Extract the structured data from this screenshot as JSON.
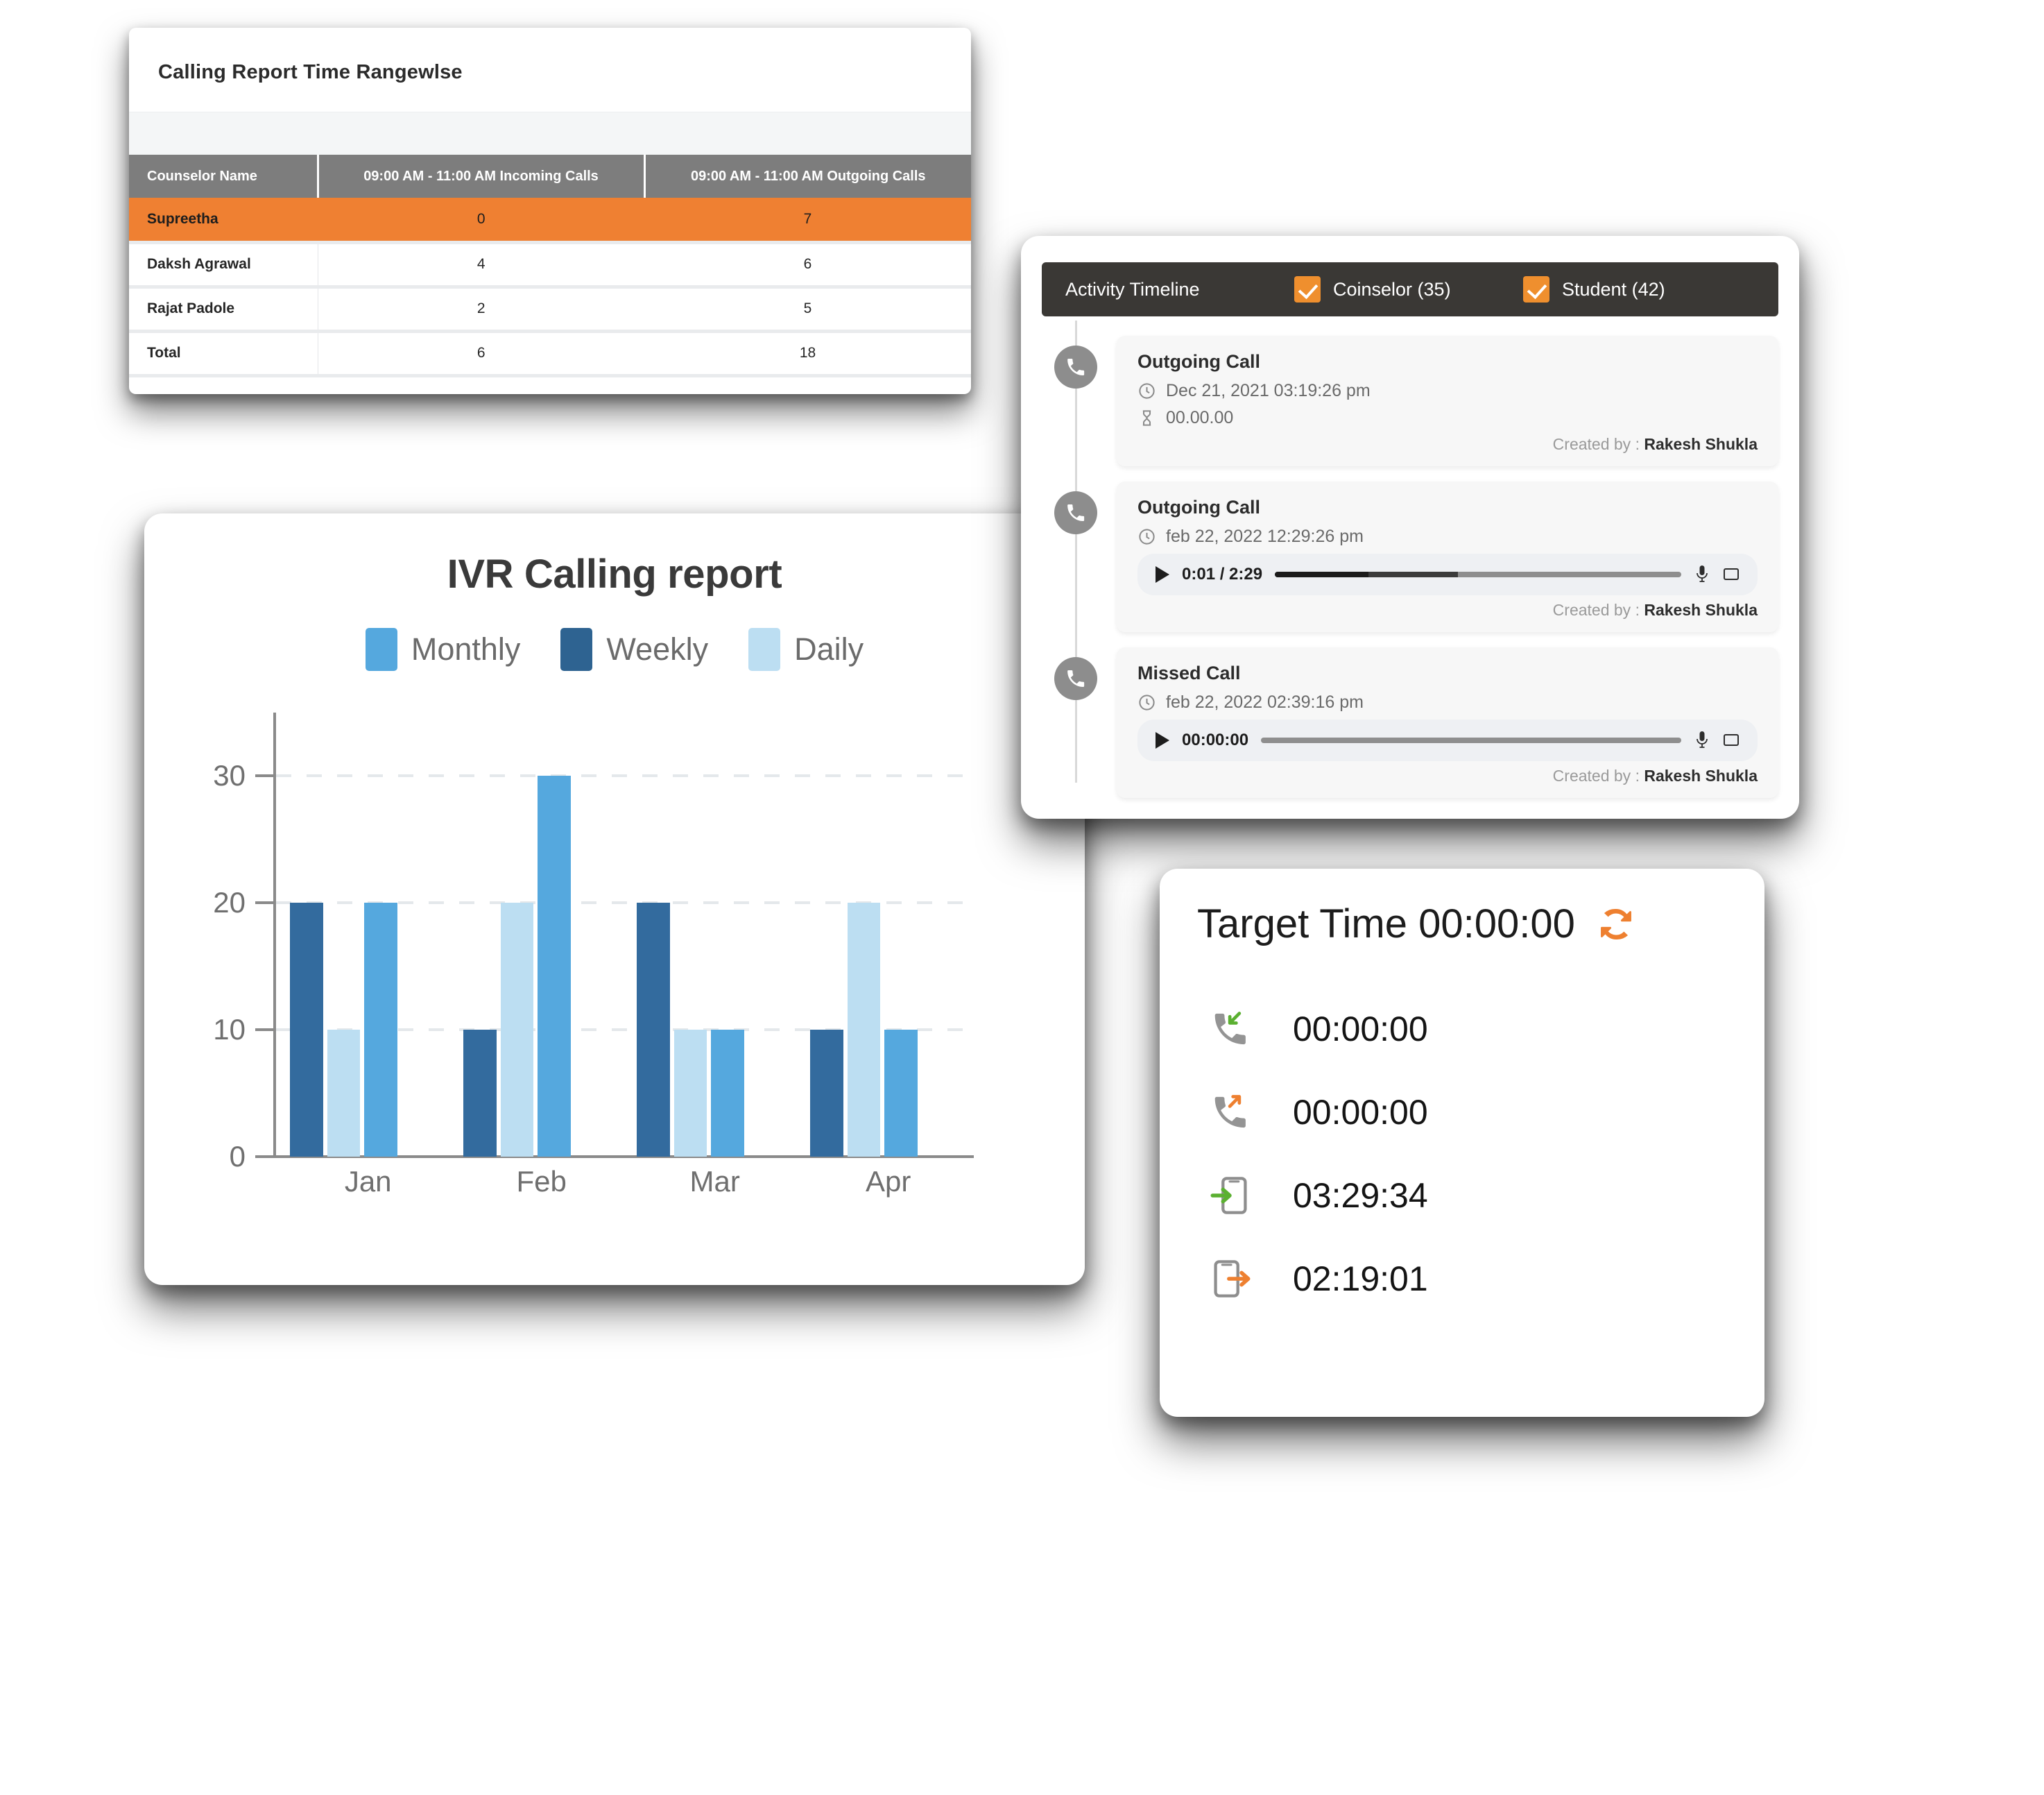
{
  "report": {
    "title": "Calling Report Time Rangewlse",
    "columns": [
      "Counselor Name",
      "09:00 AM - 11:00 AM Incoming Calls",
      "09:00 AM - 11:00 AM Outgoing Calls"
    ],
    "rows": [
      {
        "name": "Supreetha",
        "incoming": "0",
        "outgoing": "7",
        "highlight": true
      },
      {
        "name": "Daksh Agrawal",
        "incoming": "4",
        "outgoing": "6",
        "highlight": false
      },
      {
        "name": "Rajat Padole",
        "incoming": "2",
        "outgoing": "5",
        "highlight": false
      },
      {
        "name": "Total",
        "incoming": "6",
        "outgoing": "18",
        "highlight": false
      }
    ],
    "colors": {
      "header_bg": "#7d7d7d",
      "highlight_bg": "#ef8032"
    }
  },
  "chart_data": {
    "type": "bar",
    "title": "IVR Calling report",
    "xlabel": "",
    "ylabel": "",
    "categories": [
      "Jan",
      "Feb",
      "Mar",
      "Apr"
    ],
    "series": [
      {
        "name": "Weekly",
        "color": "#336b9e",
        "values": [
          20,
          10,
          20,
          10
        ]
      },
      {
        "name": "Daily",
        "color": "#bcdef2",
        "values": [
          10,
          20,
          10,
          20
        ]
      },
      {
        "name": "Monthly",
        "color": "#55a8de",
        "values": [
          20,
          30,
          10,
          10
        ]
      }
    ],
    "legend": [
      "Monthly",
      "Weekly",
      "Daily"
    ],
    "legend_colors": [
      "#55a8de",
      "#2e6391",
      "#bcdef2"
    ],
    "legend_position": "top",
    "yticks": [
      0,
      10,
      20,
      30
    ],
    "ylim": [
      0,
      35
    ],
    "grid": true
  },
  "timeline": {
    "header": {
      "title": "Activity Timeline",
      "filters": [
        {
          "label": "Coinselor (35)",
          "checked": true
        },
        {
          "label": "Student (42)",
          "checked": true
        }
      ]
    },
    "entries": [
      {
        "type": "Outgoing Call",
        "datetime": "Dec 21, 2021  03:19:26 pm",
        "duration": "00.00.00",
        "has_player": false,
        "player_time": "",
        "created_prefix": "Created by : ",
        "created_by": "Rakesh Shukla"
      },
      {
        "type": "Outgoing Call",
        "datetime": "feb 22, 2022  12:29:26 pm",
        "duration": "",
        "has_player": true,
        "player_time": "0:01 / 2:29",
        "created_prefix": "Created by : ",
        "created_by": "Rakesh Shukla"
      },
      {
        "type": "Missed Call",
        "datetime": "feb 22, 2022 02:39:16 pm",
        "duration": "",
        "has_player": true,
        "player_time": "00:00:00",
        "created_prefix": "Created by : ",
        "created_by": "Rakesh Shukla"
      }
    ],
    "colors": {
      "header_bg": "#3a3835",
      "checkbox": "#ef8f2e",
      "dot": "#8d8d8d"
    }
  },
  "target": {
    "title": "Target Time 00:00:00",
    "refresh_color": "#ee8030",
    "rows": [
      {
        "icon": "incoming-call-icon",
        "value": "00:00:00"
      },
      {
        "icon": "outgoing-call-icon",
        "value": "00:00:00"
      },
      {
        "icon": "phone-login-icon",
        "value": "03:29:34"
      },
      {
        "icon": "phone-logout-icon",
        "value": "02:19:01"
      }
    ]
  }
}
